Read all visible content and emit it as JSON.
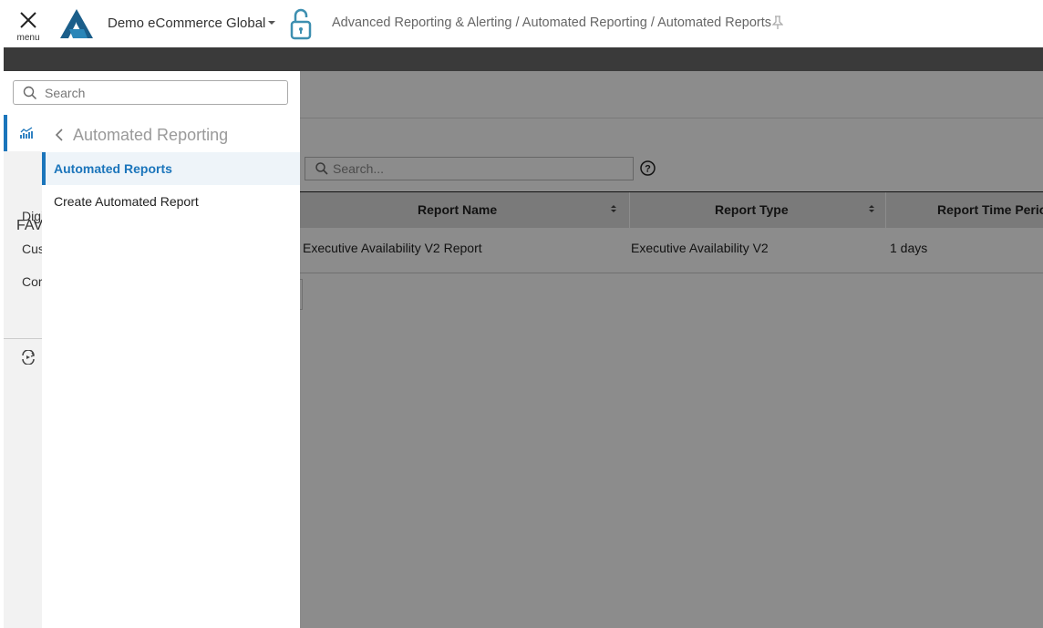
{
  "topbar": {
    "menu_label": "menu",
    "org_name": "Demo eCommerce Global",
    "breadcrumb": "Advanced Reporting & Alerting / Automated Reporting / Automated Reports",
    "colors": {
      "brand": "#1b5e8a",
      "accent": "#1b75bb",
      "lock": "#3d8fb0"
    }
  },
  "icons": {
    "menu": "close-icon",
    "caret": "caret-down-icon",
    "lock": "unlock-icon",
    "pin": "pin-icon",
    "search": "search-icon",
    "help": "help-icon",
    "chart": "chart-icon",
    "back": "chevron-left-icon"
  },
  "drawer": {
    "search_placeholder": "Search",
    "rail": {
      "fav_label": "FAV",
      "items": [
        "Digi",
        "Cus",
        "Cor"
      ]
    },
    "panel": {
      "title": "Automated Reporting",
      "items": [
        {
          "label": "Automated Reports",
          "active": true
        },
        {
          "label": "Create Automated Report",
          "active": false
        }
      ]
    }
  },
  "main": {
    "search_placeholder": "Search...",
    "table": {
      "headers": [
        "Report Name",
        "Report Type",
        "Report Time Perio"
      ],
      "rows": [
        [
          "Executive Availability V2 Report",
          "Executive Availability V2",
          "1 days"
        ]
      ]
    }
  }
}
